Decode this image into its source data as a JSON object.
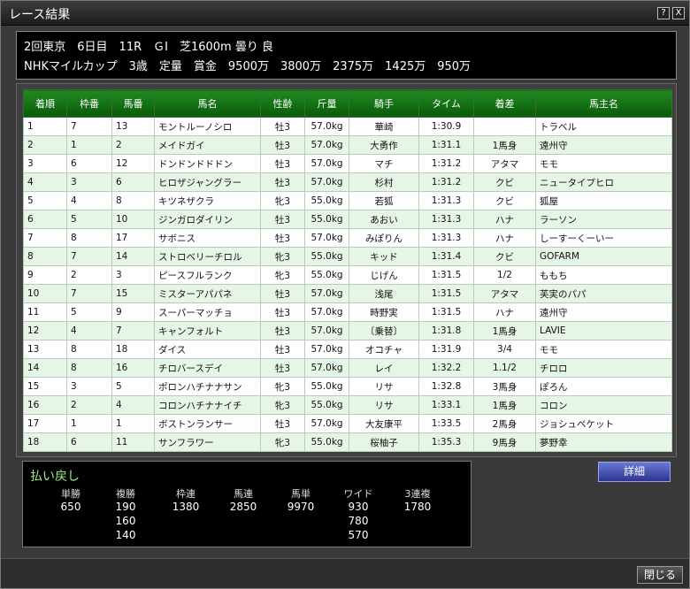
{
  "window": {
    "title": "レース結果",
    "help_label": "?",
    "close_label": "X"
  },
  "race": {
    "line1": "2回東京　6日目　11R　ＧⅠ　芝1600m 曇り 良",
    "line2": "NHKマイルカップ　3歳　定量　賞金　9500万　3800万　2375万　1425万　950万"
  },
  "table": {
    "headers": [
      "着順",
      "枠番",
      "馬番",
      "馬名",
      "性齢",
      "斤量",
      "騎手",
      "タイム",
      "着差",
      "馬主名"
    ],
    "rows": [
      [
        "1",
        "7",
        "13",
        "モントルーノシロ",
        "牡3",
        "57.0kg",
        "華崎",
        "1:30.9",
        "",
        "トラベル"
      ],
      [
        "2",
        "1",
        "2",
        "メイドガイ",
        "牡3",
        "57.0kg",
        "大勇作",
        "1:31.1",
        "1馬身",
        "遠州守"
      ],
      [
        "3",
        "6",
        "12",
        "ドンドンドドドン",
        "牡3",
        "57.0kg",
        "マチ",
        "1:31.2",
        "アタマ",
        "モモ"
      ],
      [
        "4",
        "3",
        "6",
        "ヒロザジャングラー",
        "牡3",
        "57.0kg",
        "杉村",
        "1:31.2",
        "クビ",
        "ニュータイプヒロ"
      ],
      [
        "5",
        "4",
        "8",
        "キツネザクラ",
        "牝3",
        "55.0kg",
        "若狐",
        "1:31.3",
        "クビ",
        "狐屋"
      ],
      [
        "6",
        "5",
        "10",
        "ジンガロダイリン",
        "牡3",
        "55.0kg",
        "あおい",
        "1:31.3",
        "ハナ",
        "ラーソン"
      ],
      [
        "7",
        "8",
        "17",
        "サボニス",
        "牡3",
        "57.0kg",
        "みぽりん",
        "1:31.3",
        "ハナ",
        "しーすーくーいー"
      ],
      [
        "8",
        "7",
        "14",
        "ストロベリーチロル",
        "牝3",
        "55.0kg",
        "キッド",
        "1:31.4",
        "クビ",
        "GOFARM"
      ],
      [
        "9",
        "2",
        "3",
        "ピースフルランク",
        "牝3",
        "55.0kg",
        "じげん",
        "1:31.5",
        "1/2",
        "ももち"
      ],
      [
        "10",
        "7",
        "15",
        "ミスターアパパネ",
        "牡3",
        "57.0kg",
        "浅尾",
        "1:31.5",
        "アタマ",
        "芙実のパパ"
      ],
      [
        "11",
        "5",
        "9",
        "スーパーマッチョ",
        "牡3",
        "57.0kg",
        "時野実",
        "1:31.5",
        "ハナ",
        "遠州守"
      ],
      [
        "12",
        "4",
        "7",
        "キャンフォルト",
        "牡3",
        "57.0kg",
        "〔乗替〕",
        "1:31.8",
        "1馬身",
        "LAVIE"
      ],
      [
        "13",
        "8",
        "18",
        "ダイス",
        "牡3",
        "57.0kg",
        "オコチャ",
        "1:31.9",
        "3/4",
        "モモ"
      ],
      [
        "14",
        "8",
        "16",
        "チロバースデイ",
        "牡3",
        "57.0kg",
        "レイ",
        "1:32.2",
        "1.1/2",
        "チロロ"
      ],
      [
        "15",
        "3",
        "5",
        "ポロンハチナナサン",
        "牝3",
        "55.0kg",
        "リサ",
        "1:32.8",
        "3馬身",
        "ぽろん"
      ],
      [
        "16",
        "2",
        "4",
        "コロンハチナナイチ",
        "牝3",
        "55.0kg",
        "リサ",
        "1:33.1",
        "1馬身",
        "コロン"
      ],
      [
        "17",
        "1",
        "1",
        "ボストンランサー",
        "牡3",
        "57.0kg",
        "大友康平",
        "1:33.5",
        "2馬身",
        "ジョシュペケット"
      ],
      [
        "18",
        "6",
        "11",
        "サンフラワー",
        "牝3",
        "55.0kg",
        "桜柚子",
        "1:35.3",
        "9馬身",
        "夢野幸"
      ]
    ]
  },
  "payout": {
    "title": "払い戻し",
    "columns": [
      {
        "label": "単勝",
        "values": [
          "650"
        ]
      },
      {
        "label": "複勝",
        "values": [
          "190",
          "160",
          "140"
        ]
      },
      {
        "label": "枠連",
        "values": [
          "1380"
        ]
      },
      {
        "label": "馬連",
        "values": [
          "2850"
        ]
      },
      {
        "label": "馬単",
        "values": [
          "9970"
        ]
      },
      {
        "label": "ワイド",
        "values": [
          "930",
          "780",
          "570"
        ]
      },
      {
        "label": "3連複",
        "values": [
          "1780"
        ]
      }
    ]
  },
  "buttons": {
    "detail": "詳細",
    "close": "閉じる"
  }
}
